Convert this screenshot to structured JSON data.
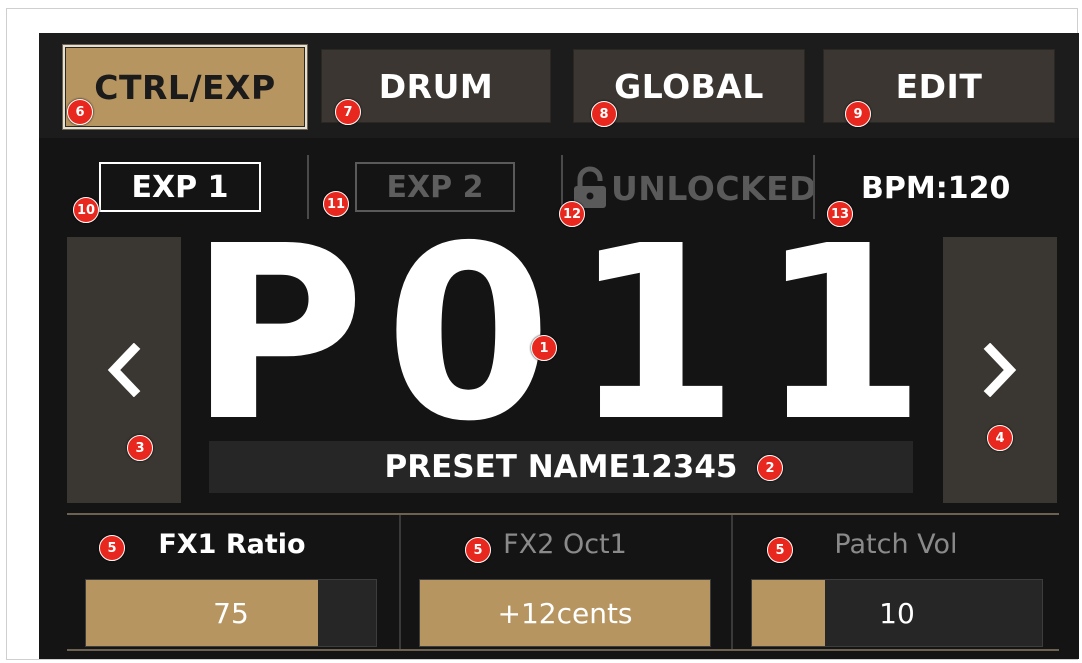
{
  "tabs": [
    {
      "label": "CTRL/EXP",
      "marker": "6",
      "active": true
    },
    {
      "label": "DRUM",
      "marker": "7",
      "active": false
    },
    {
      "label": "GLOBAL",
      "marker": "8",
      "active": false
    },
    {
      "label": "EDIT",
      "marker": "9",
      "active": false
    }
  ],
  "status": {
    "exp1": {
      "label": "EXP 1",
      "marker": "10"
    },
    "exp2": {
      "label": "EXP 2",
      "marker": "11"
    },
    "lock": {
      "label": "UNLOCKED",
      "marker": "12",
      "icon": "lock-icon"
    },
    "bpm": {
      "label": "BPM:120",
      "marker": "13"
    }
  },
  "preset": {
    "number": "P011",
    "number_marker": "1",
    "name": "PRESET NAME12345",
    "name_marker": "2",
    "prev_marker": "3",
    "next_marker": "4",
    "prev_icon": "chevron-left-icon",
    "next_icon": "chevron-right-icon"
  },
  "params": [
    {
      "label": "FX1  Ratio",
      "marker": "5",
      "value": "75",
      "fill_fraction": 0.8,
      "highlight": true
    },
    {
      "label": "FX2 Oct1",
      "marker": "5",
      "value": "+12cents",
      "fill_fraction": 1.0,
      "highlight": false
    },
    {
      "label": "Patch Vol",
      "marker": "5",
      "value": "10",
      "fill_fraction": 0.25,
      "highlight": false
    }
  ],
  "colors": {
    "accent": "#b79560",
    "background": "#141414",
    "marker": "#e8281e"
  }
}
